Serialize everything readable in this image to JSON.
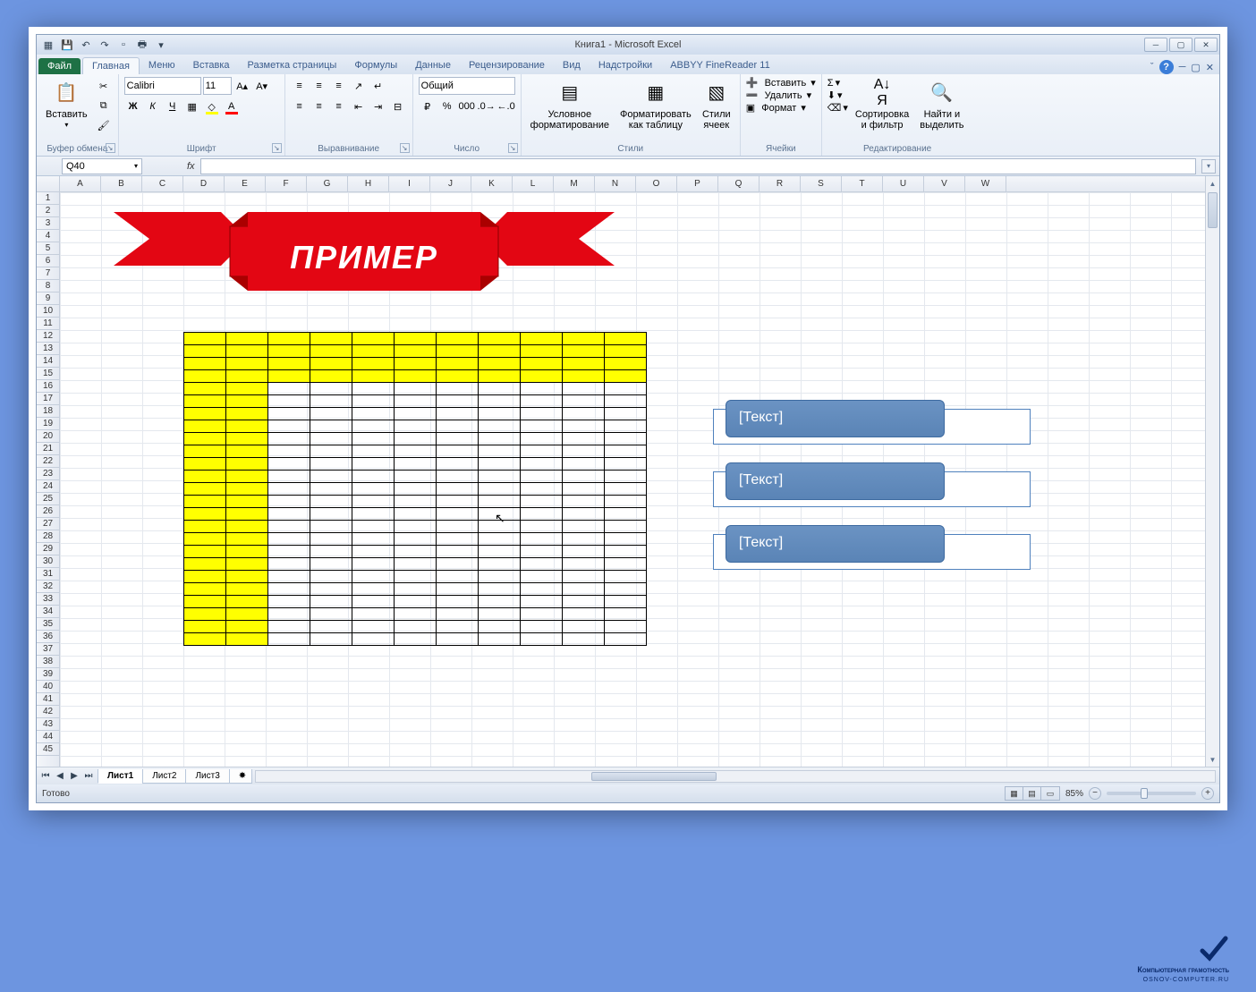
{
  "title": "Книга1 - Microsoft Excel",
  "tabs": {
    "file": "Файл",
    "items": [
      "Главная",
      "Меню",
      "Вставка",
      "Разметка страницы",
      "Формулы",
      "Данные",
      "Рецензирование",
      "Вид",
      "Надстройки",
      "ABBYY FineReader 11"
    ],
    "active_index": 0
  },
  "ribbon": {
    "clipboard": {
      "paste": "Вставить",
      "label": "Буфер обмена"
    },
    "font": {
      "name": "Calibri",
      "size": "11",
      "label": "Шрифт",
      "bold": "Ж",
      "italic": "К",
      "underline": "Ч"
    },
    "alignment": {
      "label": "Выравнивание"
    },
    "number": {
      "format": "Общий",
      "label": "Число"
    },
    "styles": {
      "cond": "Условное\nформатирование",
      "table": "Форматировать\nкак таблицу",
      "cell": "Стили\nячеек",
      "label": "Стили"
    },
    "cells": {
      "insert": "Вставить",
      "delete": "Удалить",
      "format": "Формат",
      "label": "Ячейки"
    },
    "editing": {
      "sort": "Сортировка\nи фильтр",
      "find": "Найти и\nвыделить",
      "label": "Редактирование"
    }
  },
  "namebox": "Q40",
  "fx": "",
  "columns": [
    "A",
    "B",
    "C",
    "D",
    "E",
    "F",
    "G",
    "H",
    "I",
    "J",
    "K",
    "L",
    "M",
    "N",
    "O",
    "P",
    "Q",
    "R",
    "S",
    "T",
    "U",
    "V",
    "W"
  ],
  "rows_count": 45,
  "banner_text": "ПРИМЕР",
  "table": {
    "rows": 25,
    "cols": 11,
    "yellow_header_rows": 4,
    "yellow_left_cols": 2
  },
  "smartart_items": [
    "[Текст]",
    "[Текст]",
    "[Текст]"
  ],
  "sheet_tabs": [
    "Лист1",
    "Лист2",
    "Лист3"
  ],
  "active_sheet": 0,
  "status": "Готово",
  "zoom": "85%",
  "watermark": {
    "line1": "Компьютерная грамотность",
    "line2": "OSNOV-COMPUTER.RU"
  }
}
